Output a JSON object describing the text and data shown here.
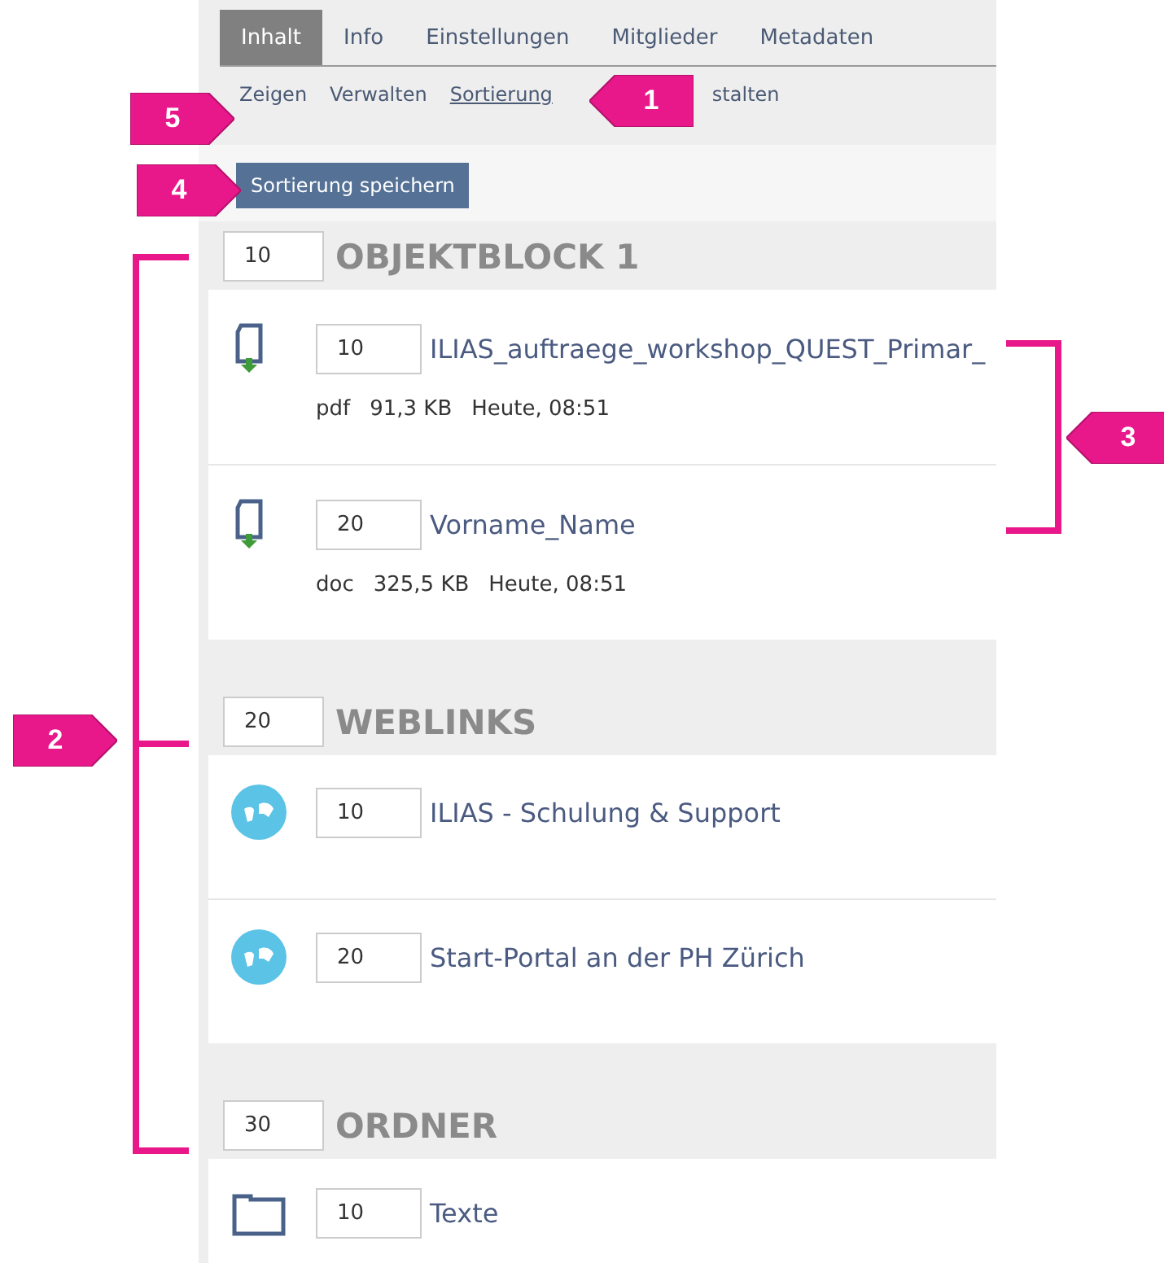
{
  "tabs": [
    {
      "label": "Inhalt",
      "selected": true
    },
    {
      "label": "Info",
      "selected": false
    },
    {
      "label": "Einstellungen",
      "selected": false
    },
    {
      "label": "Mitglieder",
      "selected": false
    },
    {
      "label": "Metadaten",
      "selected": false
    }
  ],
  "subtabs": [
    {
      "label": "Zeigen",
      "selected": false
    },
    {
      "label": "Verwalten",
      "selected": false
    },
    {
      "label": "Sortierung",
      "selected": true
    },
    {
      "label": "stalten",
      "selected": false
    }
  ],
  "save_button": "Sortierung speichern",
  "blocks": [
    {
      "order": "10",
      "title": "OBJEKTBLOCK 1",
      "items": [
        {
          "kind": "file",
          "order": "10",
          "title": "ILIAS_auftraege_workshop_QUEST_Primar_",
          "meta": [
            "pdf",
            "91,3 KB",
            "Heute, 08:51"
          ]
        },
        {
          "kind": "file",
          "order": "20",
          "title": "Vorname_Name",
          "meta": [
            "doc",
            "325,5 KB",
            "Heute, 08:51"
          ]
        }
      ]
    },
    {
      "order": "20",
      "title": "WEBLINKS",
      "items": [
        {
          "kind": "weblink",
          "order": "10",
          "title": "ILIAS - Schulung & Support"
        },
        {
          "kind": "weblink",
          "order": "20",
          "title": "Start-Portal an der PH Zürich"
        }
      ]
    },
    {
      "order": "30",
      "title": "ORDNER",
      "items": [
        {
          "kind": "folder",
          "order": "10",
          "title": "Texte"
        }
      ]
    }
  ],
  "annotations": [
    {
      "label": "5"
    },
    {
      "label": "1"
    },
    {
      "label": "4"
    },
    {
      "label": "3"
    },
    {
      "label": "2"
    }
  ]
}
